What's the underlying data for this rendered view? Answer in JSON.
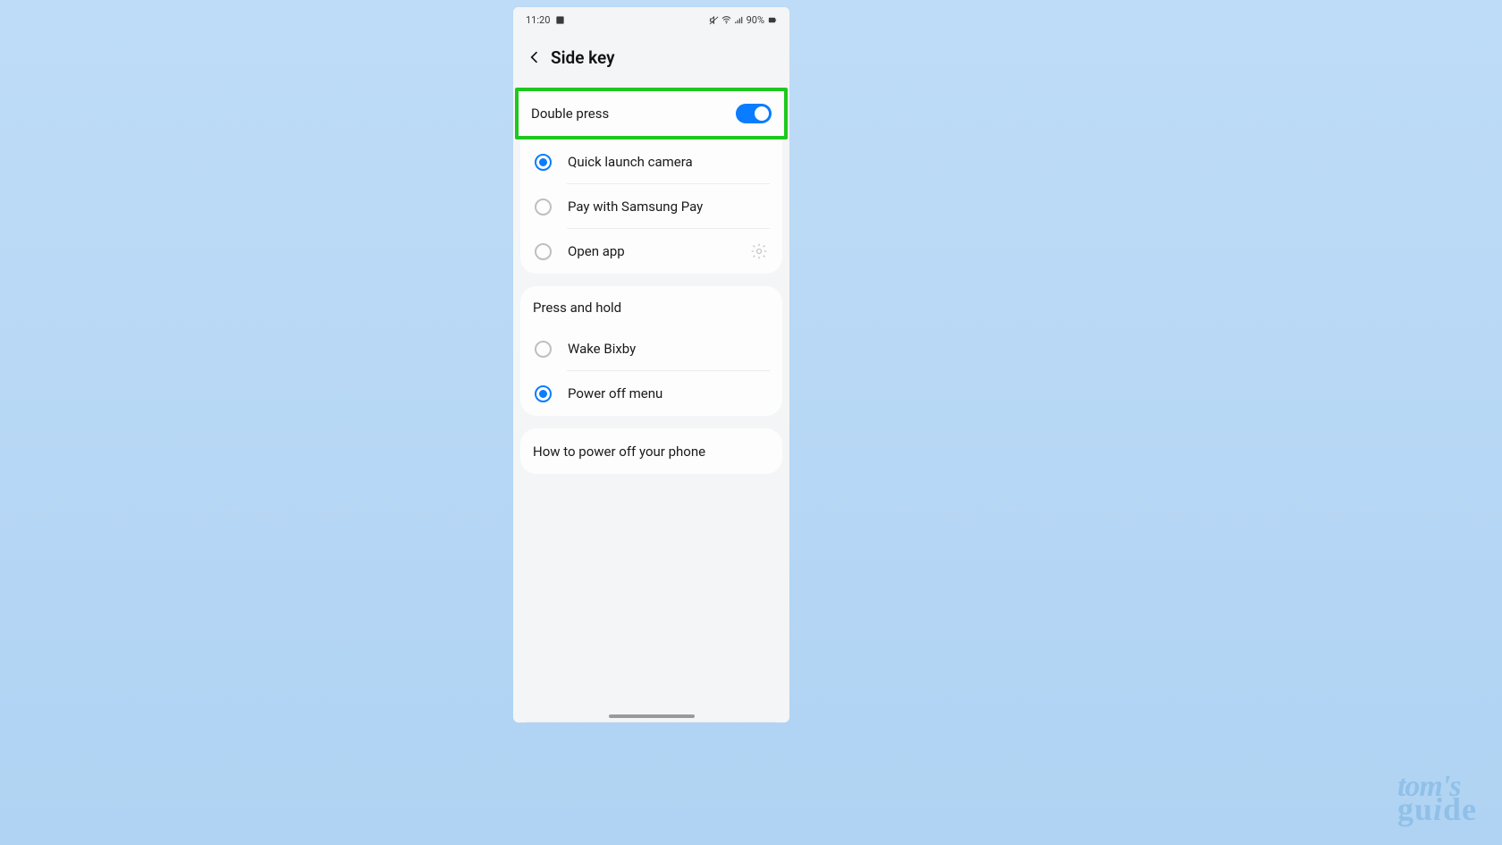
{
  "status": {
    "time": "11:20",
    "battery": "90%"
  },
  "header": {
    "title": "Side key"
  },
  "doublePress": {
    "label": "Double press",
    "toggle_on": true,
    "options": [
      {
        "label": "Quick launch camera",
        "selected": true,
        "has_gear": false
      },
      {
        "label": "Pay with Samsung Pay",
        "selected": false,
        "has_gear": false
      },
      {
        "label": "Open app",
        "selected": false,
        "has_gear": true
      }
    ]
  },
  "pressHold": {
    "label": "Press and hold",
    "options": [
      {
        "label": "Wake Bixby",
        "selected": false
      },
      {
        "label": "Power off menu",
        "selected": true
      }
    ]
  },
  "footer": {
    "label": "How to power off your phone"
  },
  "watermark": {
    "line1": "tom's",
    "line2": "guide"
  }
}
